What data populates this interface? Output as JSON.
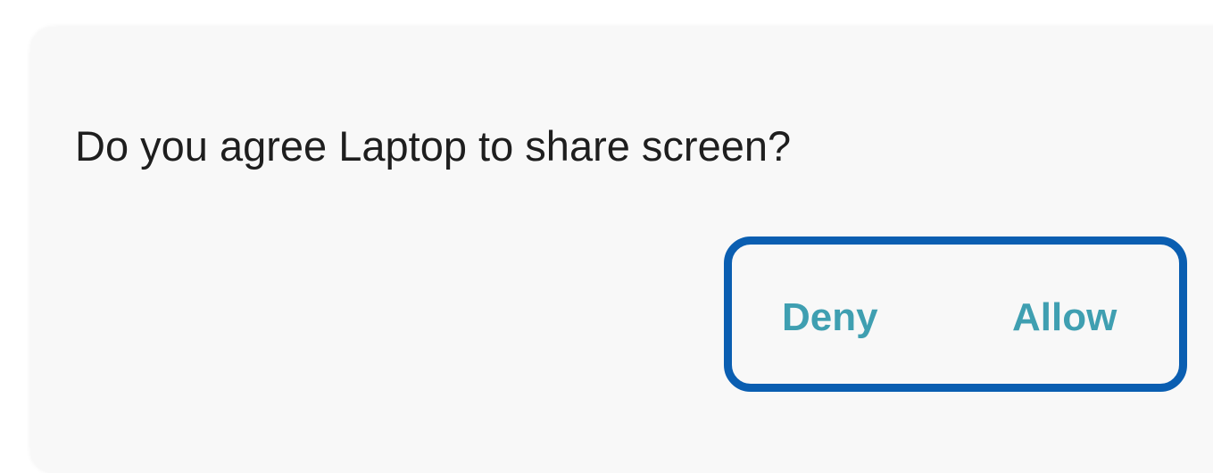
{
  "dialog": {
    "message": "Do you agree Laptop to share screen?",
    "deny_label": "Deny",
    "allow_label": "Allow"
  },
  "colors": {
    "dialog_background": "#f8f8f8",
    "message_text": "#1e1e1e",
    "button_text": "#3f9fb1",
    "highlight_border": "#0a5eb1"
  }
}
